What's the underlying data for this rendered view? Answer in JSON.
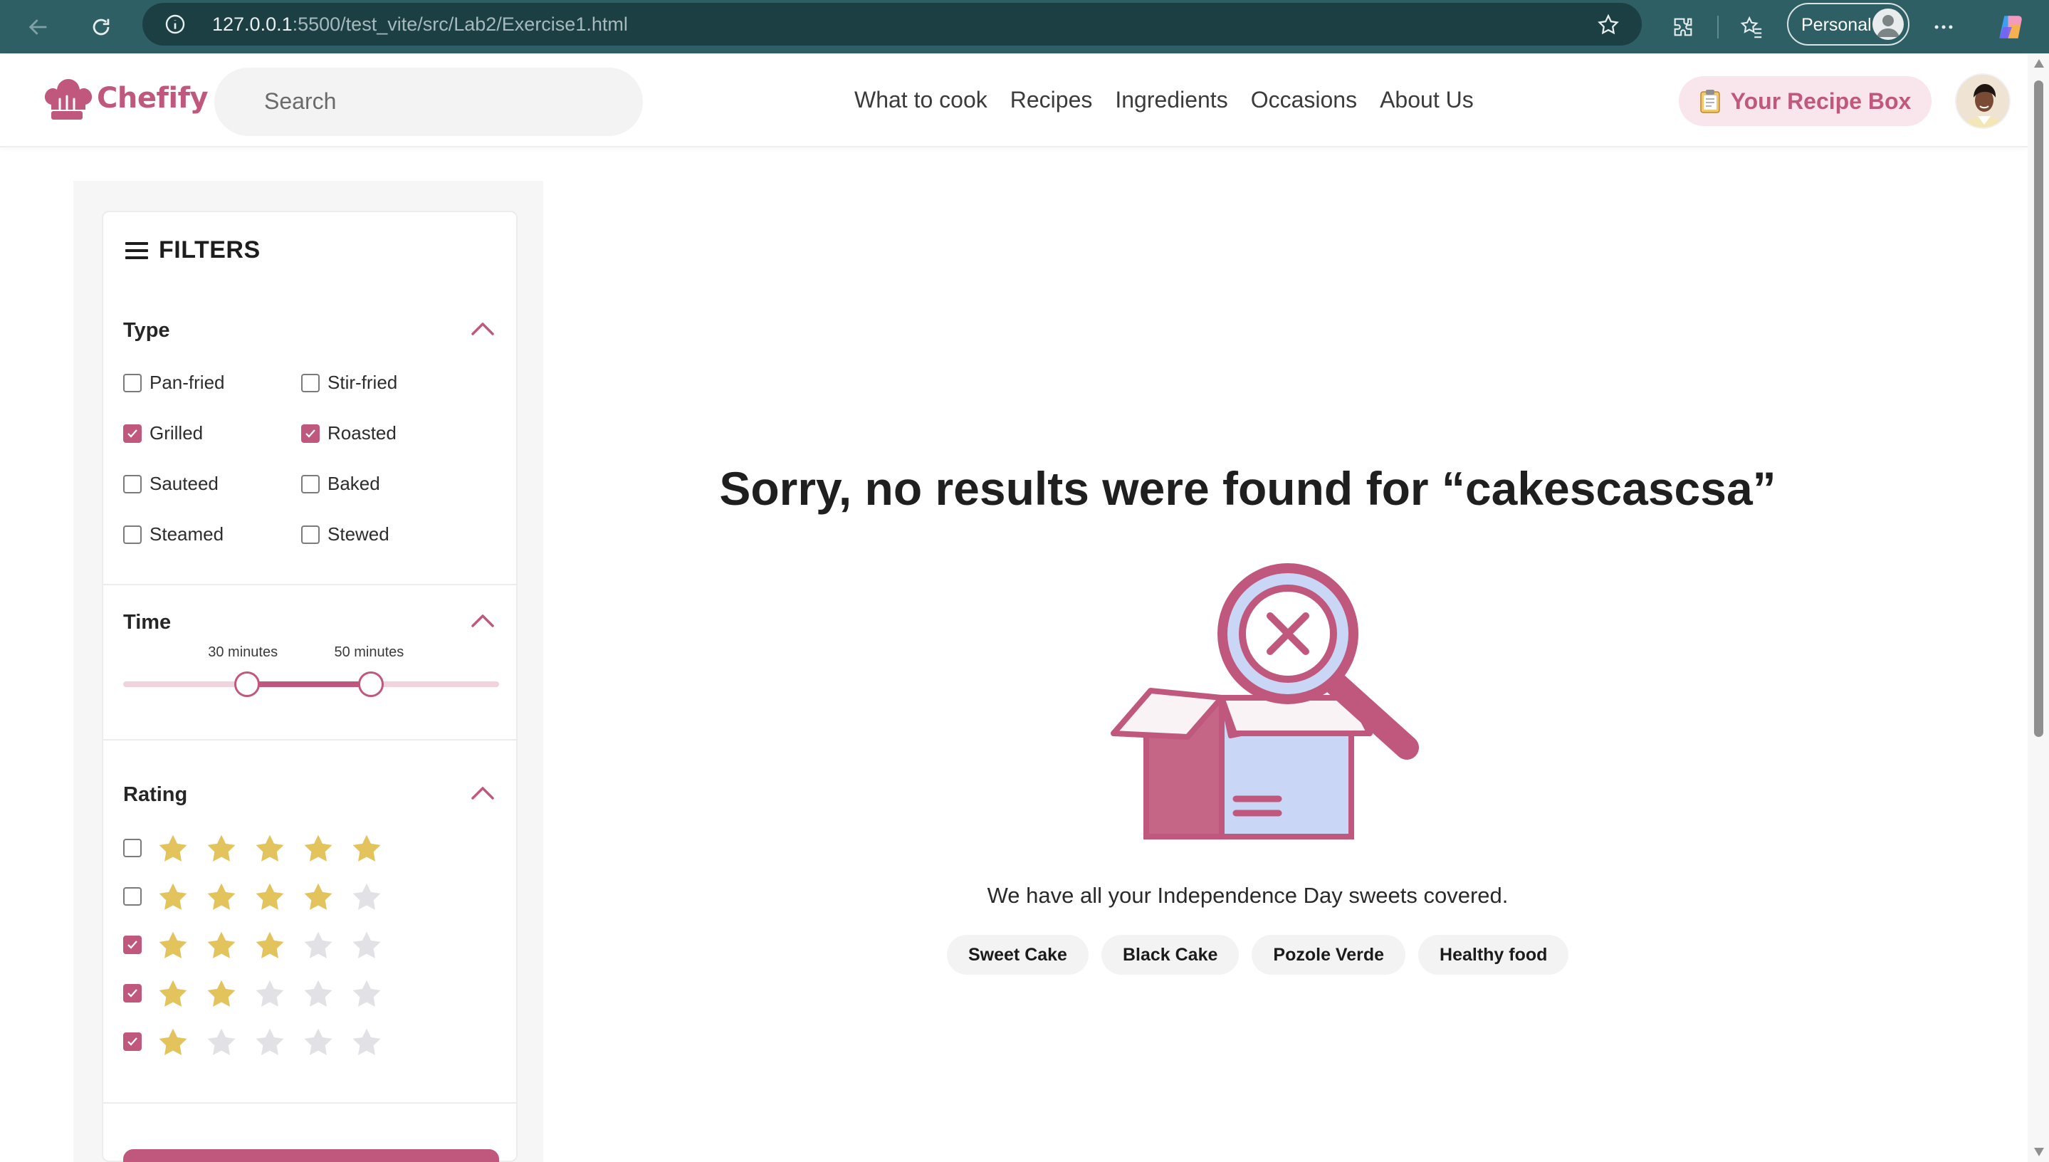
{
  "browser": {
    "url_host": "127.0.0.1",
    "url_rest": ":5500/test_vite/src/Lab2/Exercise1.html",
    "profile_label": "Personal",
    "icons": [
      "back-arrow-icon",
      "refresh-icon",
      "info-icon",
      "favorite-star-icon",
      "extensions-icon",
      "favorites-icon",
      "profile-icon",
      "more-icon",
      "copilot-icon"
    ]
  },
  "header": {
    "logo_text": "Chefify",
    "search_placeholder": "Search",
    "nav": [
      "What to cook",
      "Recipes",
      "Ingredients",
      "Occasions",
      "About Us"
    ],
    "recipe_box_label": "Your Recipe Box"
  },
  "filters": {
    "title": "FILTERS",
    "type": {
      "heading": "Type",
      "options": [
        {
          "label": "Pan-fried",
          "checked": false
        },
        {
          "label": "Stir-fried",
          "checked": false
        },
        {
          "label": "Grilled",
          "checked": true
        },
        {
          "label": "Roasted",
          "checked": true
        },
        {
          "label": "Sauteed",
          "checked": false
        },
        {
          "label": "Baked",
          "checked": false
        },
        {
          "label": "Steamed",
          "checked": false
        },
        {
          "label": "Stewed",
          "checked": false
        }
      ]
    },
    "time": {
      "heading": "Time",
      "min_label": "30 minutes",
      "max_label": "50 minutes",
      "range_fraction": [
        0.33,
        0.66
      ]
    },
    "rating": {
      "heading": "Rating",
      "rows": [
        {
          "stars": 5,
          "checked": false
        },
        {
          "stars": 4,
          "checked": false
        },
        {
          "stars": 3,
          "checked": true
        },
        {
          "stars": 2,
          "checked": true
        },
        {
          "stars": 1,
          "checked": true
        }
      ]
    }
  },
  "results": {
    "title": "Sorry, no results were found for “cakescascsa”",
    "subtitle": "We have all your Independence Day sweets covered.",
    "suggestions": [
      "Sweet Cake",
      "Black Cake",
      "Pozole Verde",
      "Healthy food"
    ]
  },
  "colors": {
    "brand": "#c0587d",
    "brand_light": "#f9e6ec",
    "star_filled": "#e3c35c",
    "star_empty": "#e2e2e6",
    "chrome": "#2d5f64"
  }
}
